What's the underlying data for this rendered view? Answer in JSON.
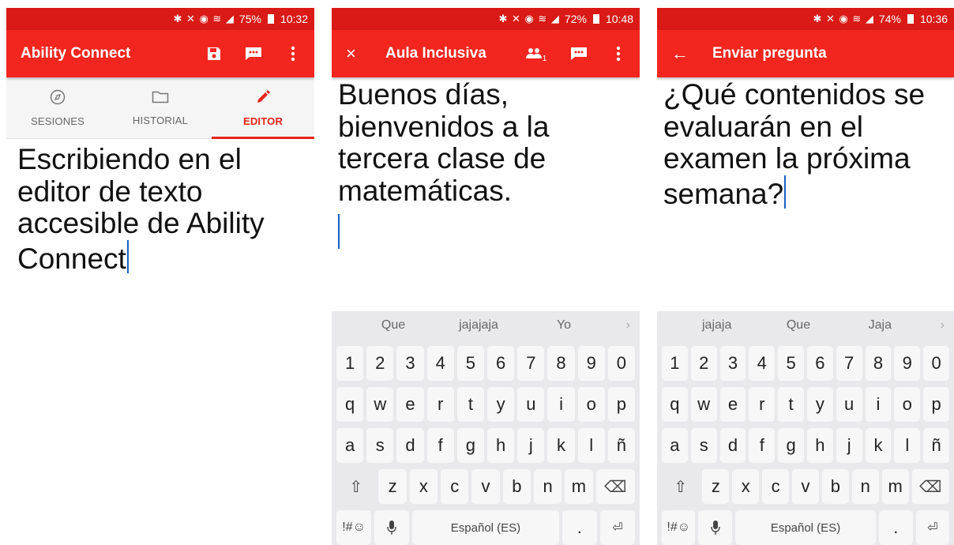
{
  "screens": [
    {
      "status": {
        "icons": "✱ ✕ ◉ ≋ ◢",
        "battery": "75%",
        "time": "10:32"
      },
      "appbar": {
        "title": "Ability Connect",
        "actions": [
          "save-icon",
          "chat-icon",
          "more-vert-icon"
        ]
      },
      "tabs": [
        {
          "label": "SESIONES",
          "icon": "compass-icon"
        },
        {
          "label": "HISTORIAL",
          "icon": "folder-icon"
        },
        {
          "label": "EDITOR",
          "icon": "pencil-icon",
          "active": true
        }
      ],
      "editor_text": "Escribiendo en el editor de texto accesible de Ability Connect"
    },
    {
      "status": {
        "icons": "✱ ✕ ◉ ≋ ◢",
        "battery": "72%",
        "time": "10:48"
      },
      "appbar": {
        "close": "×",
        "title": "Aula Inclusiva",
        "participants_count": "1"
      },
      "editor_text": "Buenos días, bienvenidos a la tercera clase de matemáticas.",
      "keyboard": {
        "suggestions": [
          "Que",
          "jajajaja",
          "Yo"
        ],
        "row1": [
          "1",
          "2",
          "3",
          "4",
          "5",
          "6",
          "7",
          "8",
          "9",
          "0"
        ],
        "row2": [
          "q",
          "w",
          "e",
          "r",
          "t",
          "y",
          "u",
          "i",
          "o",
          "p"
        ],
        "row3": [
          "a",
          "s",
          "d",
          "f",
          "g",
          "h",
          "j",
          "k",
          "l",
          "ñ"
        ],
        "row4": [
          "z",
          "x",
          "c",
          "v",
          "b",
          "n",
          "m"
        ],
        "symbols": "!#☺",
        "space": "Español (ES)",
        "period": "."
      }
    },
    {
      "status": {
        "icons": "✱ ✕ ◉ ≋ ◢",
        "battery": "74%",
        "time": "10:36"
      },
      "appbar": {
        "back": "←",
        "title": "Enviar pregunta"
      },
      "editor_text": "¿Qué contenidos se evaluarán en el examen la próxima semana?",
      "keyboard": {
        "suggestions": [
          "jajaja",
          "Que",
          "Jaja"
        ],
        "row1": [
          "1",
          "2",
          "3",
          "4",
          "5",
          "6",
          "7",
          "8",
          "9",
          "0"
        ],
        "row2": [
          "q",
          "w",
          "e",
          "r",
          "t",
          "y",
          "u",
          "i",
          "o",
          "p"
        ],
        "row3": [
          "a",
          "s",
          "d",
          "f",
          "g",
          "h",
          "j",
          "k",
          "l",
          "ñ"
        ],
        "row4": [
          "z",
          "x",
          "c",
          "v",
          "b",
          "n",
          "m"
        ],
        "symbols": "!#☺",
        "space": "Español (ES)",
        "period": "."
      }
    }
  ],
  "colors": {
    "appbar": "#f2261e",
    "statusbar": "#d91a16",
    "accent": "#e8231b",
    "caret": "#1a5fbf"
  }
}
